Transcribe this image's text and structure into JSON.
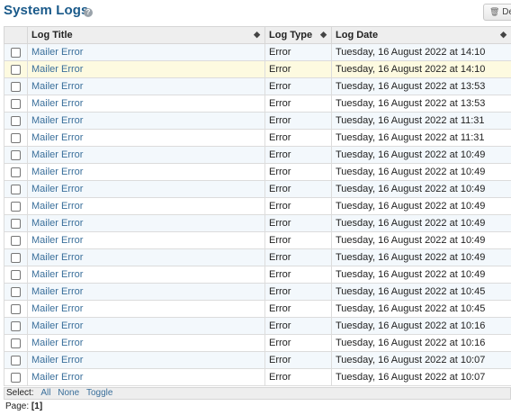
{
  "header": {
    "title": "System Logs",
    "help_glyph": "?",
    "delete_label": "De"
  },
  "columns": {
    "title": "Log Title",
    "type": "Log Type",
    "date": "Log Date"
  },
  "rows": [
    {
      "title": "Mailer Error",
      "type": "Error",
      "date": "Tuesday, 16 August 2022 at 14:10"
    },
    {
      "title": "Mailer Error",
      "type": "Error",
      "date": "Tuesday, 16 August 2022 at 14:10"
    },
    {
      "title": "Mailer Error",
      "type": "Error",
      "date": "Tuesday, 16 August 2022 at 13:53"
    },
    {
      "title": "Mailer Error",
      "type": "Error",
      "date": "Tuesday, 16 August 2022 at 13:53"
    },
    {
      "title": "Mailer Error",
      "type": "Error",
      "date": "Tuesday, 16 August 2022 at 11:31"
    },
    {
      "title": "Mailer Error",
      "type": "Error",
      "date": "Tuesday, 16 August 2022 at 11:31"
    },
    {
      "title": "Mailer Error",
      "type": "Error",
      "date": "Tuesday, 16 August 2022 at 10:49"
    },
    {
      "title": "Mailer Error",
      "type": "Error",
      "date": "Tuesday, 16 August 2022 at 10:49"
    },
    {
      "title": "Mailer Error",
      "type": "Error",
      "date": "Tuesday, 16 August 2022 at 10:49"
    },
    {
      "title": "Mailer Error",
      "type": "Error",
      "date": "Tuesday, 16 August 2022 at 10:49"
    },
    {
      "title": "Mailer Error",
      "type": "Error",
      "date": "Tuesday, 16 August 2022 at 10:49"
    },
    {
      "title": "Mailer Error",
      "type": "Error",
      "date": "Tuesday, 16 August 2022 at 10:49"
    },
    {
      "title": "Mailer Error",
      "type": "Error",
      "date": "Tuesday, 16 August 2022 at 10:49"
    },
    {
      "title": "Mailer Error",
      "type": "Error",
      "date": "Tuesday, 16 August 2022 at 10:49"
    },
    {
      "title": "Mailer Error",
      "type": "Error",
      "date": "Tuesday, 16 August 2022 at 10:45"
    },
    {
      "title": "Mailer Error",
      "type": "Error",
      "date": "Tuesday, 16 August 2022 at 10:45"
    },
    {
      "title": "Mailer Error",
      "type": "Error",
      "date": "Tuesday, 16 August 2022 at 10:16"
    },
    {
      "title": "Mailer Error",
      "type": "Error",
      "date": "Tuesday, 16 August 2022 at 10:16"
    },
    {
      "title": "Mailer Error",
      "type": "Error",
      "date": "Tuesday, 16 August 2022 at 10:07"
    },
    {
      "title": "Mailer Error",
      "type": "Error",
      "date": "Tuesday, 16 August 2022 at 10:07"
    }
  ],
  "highlighted_row": 1,
  "footer": {
    "select_label": "Select:",
    "all": "All",
    "none": "None",
    "toggle": "Toggle"
  },
  "pager": {
    "label": "Page:",
    "current": "[1]"
  },
  "colors": {
    "title": "#1a5a8a",
    "link": "#3a6f9b",
    "row_alt": "#f3f8fc",
    "row_highlight": "#fdfae0"
  }
}
